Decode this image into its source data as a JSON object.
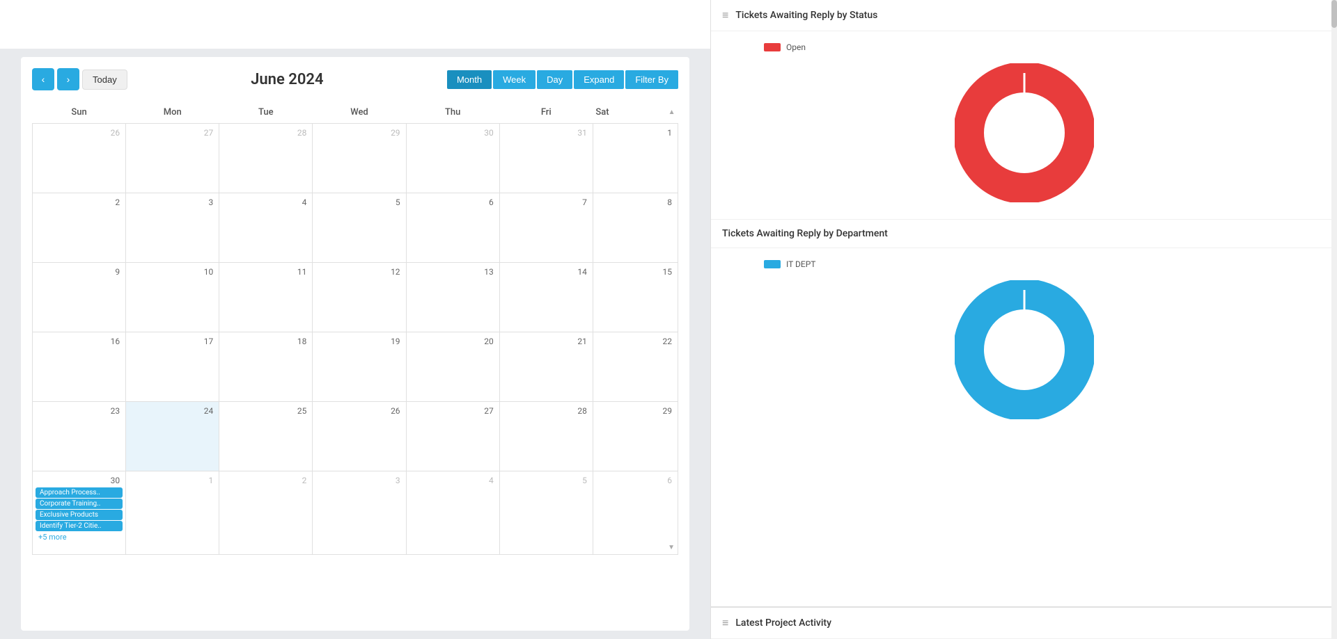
{
  "calendar": {
    "title": "June 2024",
    "nav": {
      "prev_label": "‹",
      "next_label": "›",
      "today_label": "Today"
    },
    "view_buttons": [
      "Month",
      "Week",
      "Day",
      "Expand",
      "Filter By"
    ],
    "active_view": "Month",
    "days_header": [
      "Sun",
      "Mon",
      "Tue",
      "Wed",
      "Thu",
      "Fri",
      "Sat"
    ],
    "weeks": [
      {
        "days": [
          {
            "num": "26",
            "other": true
          },
          {
            "num": "27",
            "other": true
          },
          {
            "num": "28",
            "other": true
          },
          {
            "num": "29",
            "other": true
          },
          {
            "num": "30",
            "other": true
          },
          {
            "num": "31",
            "other": true
          },
          {
            "num": "1",
            "other": false
          }
        ]
      },
      {
        "days": [
          {
            "num": "2",
            "other": false
          },
          {
            "num": "3",
            "other": false
          },
          {
            "num": "4",
            "other": false
          },
          {
            "num": "5",
            "other": false
          },
          {
            "num": "6",
            "other": false
          },
          {
            "num": "7",
            "other": false
          },
          {
            "num": "8",
            "other": false
          }
        ]
      },
      {
        "days": [
          {
            "num": "9",
            "other": false
          },
          {
            "num": "10",
            "other": false
          },
          {
            "num": "11",
            "other": false
          },
          {
            "num": "12",
            "other": false
          },
          {
            "num": "13",
            "other": false
          },
          {
            "num": "14",
            "other": false
          },
          {
            "num": "15",
            "other": false
          }
        ]
      },
      {
        "days": [
          {
            "num": "16",
            "other": false
          },
          {
            "num": "17",
            "other": false
          },
          {
            "num": "18",
            "other": false
          },
          {
            "num": "19",
            "other": false
          },
          {
            "num": "20",
            "other": false
          },
          {
            "num": "21",
            "other": false
          },
          {
            "num": "22",
            "other": false
          }
        ]
      },
      {
        "days": [
          {
            "num": "23",
            "other": false
          },
          {
            "num": "24",
            "today": true,
            "other": false
          },
          {
            "num": "25",
            "other": false
          },
          {
            "num": "26",
            "other": false
          },
          {
            "num": "27",
            "other": false
          },
          {
            "num": "28",
            "other": false
          },
          {
            "num": "29",
            "other": false
          }
        ]
      },
      {
        "days": [
          {
            "num": "30",
            "other": false,
            "has_events": true
          },
          {
            "num": "1",
            "other": true
          },
          {
            "num": "2",
            "other": true
          },
          {
            "num": "3",
            "other": true
          },
          {
            "num": "4",
            "other": true
          },
          {
            "num": "5",
            "other": true
          },
          {
            "num": "6",
            "other": true
          }
        ]
      }
    ],
    "events": {
      "30": [
        "Approach Process..",
        "Corporate Training..",
        "Exclusive Products",
        "Identify Tier-2 Citie.."
      ],
      "30_more": "+5 more"
    }
  },
  "right_panel": {
    "tickets_by_status": {
      "title": "Tickets Awaiting Reply by Status",
      "legend": [
        {
          "label": "Open",
          "color": "#e83c3c"
        }
      ],
      "donut": {
        "color": "#e83c3c",
        "value": 100
      }
    },
    "tickets_by_dept": {
      "title": "Tickets Awaiting Reply by Department",
      "legend": [
        {
          "label": "IT DEPT",
          "color": "#29aae1"
        }
      ],
      "donut": {
        "color": "#29aae1",
        "value": 100
      }
    },
    "latest_activity": {
      "title": "Latest Project Activity"
    }
  }
}
